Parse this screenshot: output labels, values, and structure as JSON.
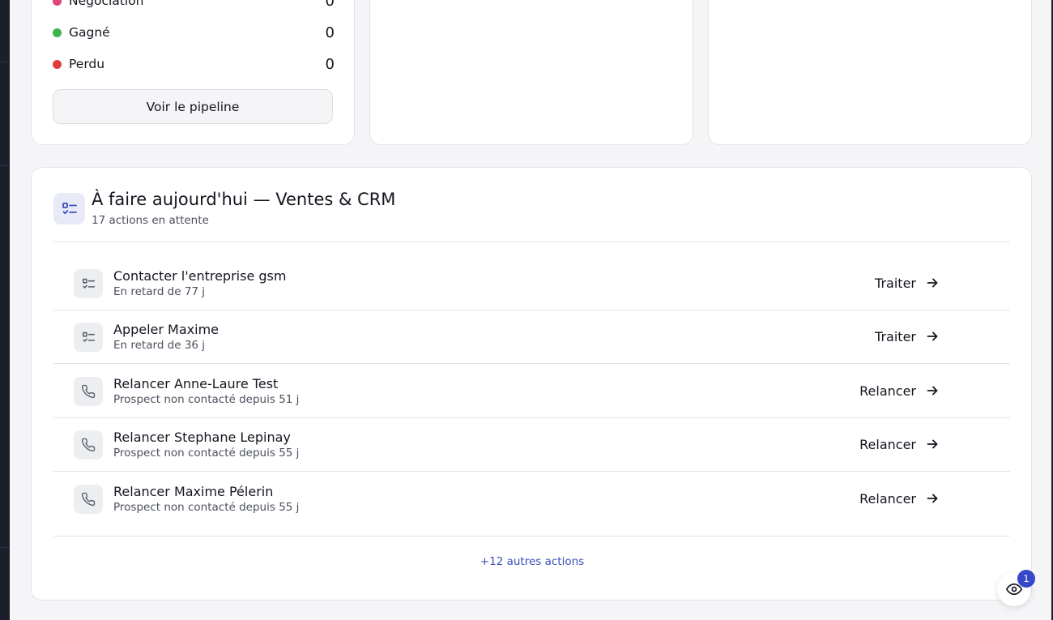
{
  "colors": {
    "accent": "#3d4fb8",
    "badge": "#3548c8",
    "stage_negociation": "#e0457b",
    "stage_gagne": "#3ab54a",
    "stage_perdu": "#e03c3c"
  },
  "pipeline": {
    "stages": [
      {
        "label": "Négociation",
        "count": "0"
      },
      {
        "label": "Gagné",
        "count": "0"
      },
      {
        "label": "Perdu",
        "count": "0"
      }
    ],
    "button_label": "Voir le pipeline"
  },
  "todo": {
    "icon": "checklist-icon",
    "title": "À faire aujourd'hui — Ventes & CRM",
    "subtitle": "17 actions en attente",
    "tasks": [
      {
        "icon": "checklist-icon",
        "title": "Contacter l'entreprise gsm",
        "subtitle": "En retard de 77 j",
        "action": "Traiter"
      },
      {
        "icon": "checklist-icon",
        "title": "Appeler Maxime",
        "subtitle": "En retard de 36 j",
        "action": "Traiter"
      },
      {
        "icon": "phone-icon",
        "title": "Relancer Anne-Laure Test",
        "subtitle": "Prospect non contacté depuis 51 j",
        "action": "Relancer"
      },
      {
        "icon": "phone-icon",
        "title": "Relancer Stephane Lepinay",
        "subtitle": "Prospect non contacté depuis 55 j",
        "action": "Relancer"
      },
      {
        "icon": "phone-icon",
        "title": "Relancer Maxime Pélerin",
        "subtitle": "Prospect non contacté depuis 55 j",
        "action": "Relancer"
      }
    ],
    "more_link": "+12 autres actions"
  },
  "fab": {
    "icon": "eye-icon",
    "badge": "1"
  }
}
